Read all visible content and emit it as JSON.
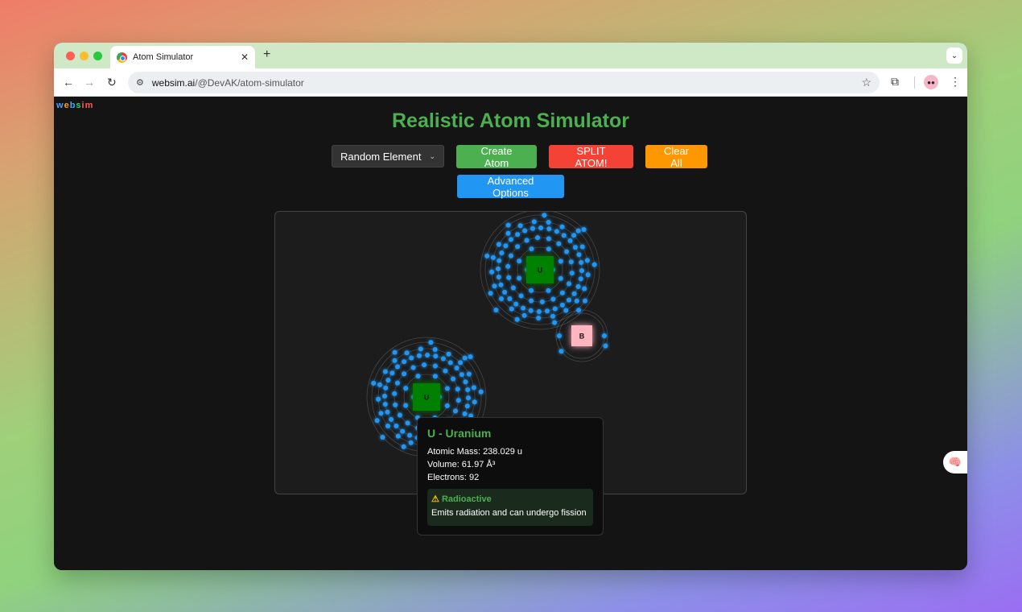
{
  "browser": {
    "tab_title": "Atom Simulator",
    "tab_close": "✕",
    "new_tab": "+",
    "url_host": "websim.ai",
    "url_path": "/@DevAK/atom-simulator"
  },
  "app": {
    "logo_letters": [
      "w",
      "e",
      "b",
      "s",
      "i",
      "m"
    ],
    "title": "Realistic Atom Simulator",
    "element_select_value": "Random Element",
    "create_button": "Create Atom",
    "split_button": "SPLIT ATOM!",
    "clear_button": "Clear All",
    "advanced_button": "Advanced Options"
  },
  "atoms": [
    {
      "symbol": "U",
      "nucleus_color": "#008000"
    },
    {
      "symbol": "B",
      "nucleus_color": "#ffb6c1"
    },
    {
      "symbol": "U",
      "nucleus_color": "#008000"
    }
  ],
  "tooltip": {
    "title": "U - Uranium",
    "mass": "Atomic Mass: 238.029 u",
    "volume": "Volume: 61.97 Å³",
    "electrons": "Electrons: 92",
    "warning_icon": "⚠",
    "warning_title": "Radioactive",
    "warning_text": "Emits radiation and can undergo fission"
  },
  "colors": {
    "accent_green": "#4caf50",
    "electron_blue": "#2196f3",
    "danger_red": "#f44336",
    "warning_orange": "#ff9800"
  }
}
